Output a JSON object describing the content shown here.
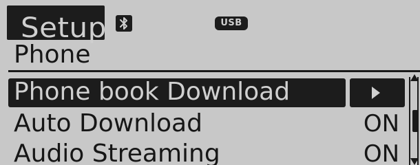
{
  "header": {
    "title": "Setup",
    "bluetooth_icon": "bluetooth-icon",
    "usb_label": "USB"
  },
  "section": {
    "title": "Phone"
  },
  "menu": {
    "items": [
      {
        "label": "Phone book Download",
        "value": "",
        "selected": true,
        "icon": "chevron-right-icon"
      },
      {
        "label": "Auto Download",
        "value": "ON",
        "selected": false
      },
      {
        "label": "Audio Streaming",
        "value": "ON",
        "selected": false
      }
    ]
  },
  "colors": {
    "background": "#c8c8c8",
    "dark": "#1c1c1c",
    "inverse_text": "#d0d0d0"
  }
}
